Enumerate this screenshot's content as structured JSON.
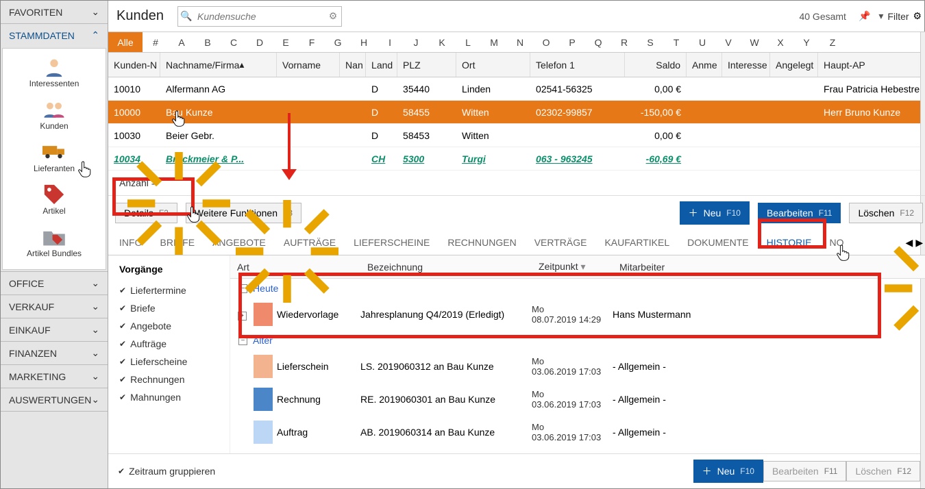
{
  "nav": {
    "favoriten": "FAVORITEN",
    "stammdaten": "STAMMDATEN",
    "items": [
      "Interessenten",
      "Kunden",
      "Lieferanten",
      "Artikel",
      "Artikel Bundles"
    ],
    "sections": [
      "OFFICE",
      "VERKAUF",
      "EINKAUF",
      "FINANZEN",
      "MARKETING",
      "AUSWERTUNGEN"
    ]
  },
  "top": {
    "title": "Kunden",
    "placeholder": "Kundensuche",
    "count": "40 Gesamt",
    "filter": "Filter"
  },
  "alpha": {
    "all": "Alle",
    "letters": [
      "#",
      "A",
      "B",
      "C",
      "D",
      "E",
      "F",
      "G",
      "H",
      "I",
      "J",
      "K",
      "L",
      "M",
      "N",
      "O",
      "P",
      "Q",
      "R",
      "S",
      "T",
      "U",
      "V",
      "W",
      "X",
      "Y",
      "Z"
    ]
  },
  "cols": {
    "kn": "Kunden-N",
    "nn": "Nachname/Firma",
    "vn": "Vorname",
    "nan": "Nan",
    "land": "Land",
    "plz": "PLZ",
    "ort": "Ort",
    "tel": "Telefon 1",
    "sal": "Saldo",
    "anm": "Anme",
    "int": "Interesse",
    "ang": "Angelegt",
    "hap": "Haupt-AP"
  },
  "rows": [
    {
      "kn": "10010",
      "nn": "Alfermann AG",
      "land": "D",
      "plz": "35440",
      "ort": "Linden",
      "tel": "02541-56325",
      "sal": "0,00 €",
      "hap": "Frau Patricia Hebestreit"
    },
    {
      "kn": "10000",
      "nn": "Bau Kunze",
      "land": "D",
      "plz": "58455",
      "ort": "Witten",
      "tel": "02302-99857",
      "sal": "-150,00 €",
      "hap": "Herr Bruno Kunze"
    },
    {
      "kn": "10030",
      "nn": "Beier Gebr.",
      "land": "D",
      "plz": "58453",
      "ort": "Witten",
      "tel": "",
      "sal": "0,00 €",
      "hap": ""
    },
    {
      "kn": "10034",
      "nn": "Bruckmeier & P...",
      "land": "CH",
      "plz": "5300",
      "ort": "Turgi",
      "tel": "063 - 963245",
      "sal": "-60,69 €",
      "hap": ""
    }
  ],
  "anz": "Anzahl =",
  "btns": {
    "details": "Details",
    "detailsF": "F2",
    "wf": "Weitere Funktionen",
    "wfF": "F3",
    "neu": "Neu",
    "neuF": "F10",
    "bearb": "Bearbeiten",
    "bearbF": "F11",
    "del": "Löschen",
    "delF": "F12"
  },
  "tabs": [
    "INFO",
    "BRIEFE",
    "ANGEBOTE",
    "AUFTRÄGE",
    "LIEFERSCHEINE",
    "RECHNUNGEN",
    "VERTRÄGE",
    "KAUFARTIKEL",
    "DOKUMENTE",
    "HISTORIE",
    "NO"
  ],
  "filters": {
    "title": "Vorgänge",
    "items": [
      "Liefertermine",
      "Briefe",
      "Angebote",
      "Aufträge",
      "Lieferscheine",
      "Rechnungen",
      "Mahnungen"
    ],
    "group": "Zeitraum gruppieren"
  },
  "hcols": {
    "art": "Art",
    "bez": "Bezeichnung",
    "zp": "Zeitpunkt",
    "mit": "Mitarbeiter"
  },
  "groups": {
    "heute": "Heute",
    "aelter": "Älter"
  },
  "hist": [
    {
      "color": "#f08a6c",
      "art": "Wiedervorlage",
      "bez": "Jahresplanung Q4/2019 (Erledigt)",
      "zp": "Mo 08.07.2019 14:29",
      "mit": "Hans Mustermann",
      "exp": "+"
    },
    {
      "color": "#f3b38f",
      "art": "Lieferschein",
      "bez": "LS. 2019060312 an Bau Kunze",
      "zp": "Mo 03.06.2019 17:03",
      "mit": "- Allgemein -"
    },
    {
      "color": "#4b86c8",
      "art": "Rechnung",
      "bez": "RE. 2019060301 an Bau Kunze",
      "zp": "Mo 03.06.2019 17:03",
      "mit": "- Allgemein -"
    },
    {
      "color": "#bcd7f5",
      "art": "Auftrag",
      "bez": "AB. 2019060314 an Bau Kunze",
      "zp": "Mo 03.06.2019 17:03",
      "mit": "- Allgemein -"
    }
  ]
}
